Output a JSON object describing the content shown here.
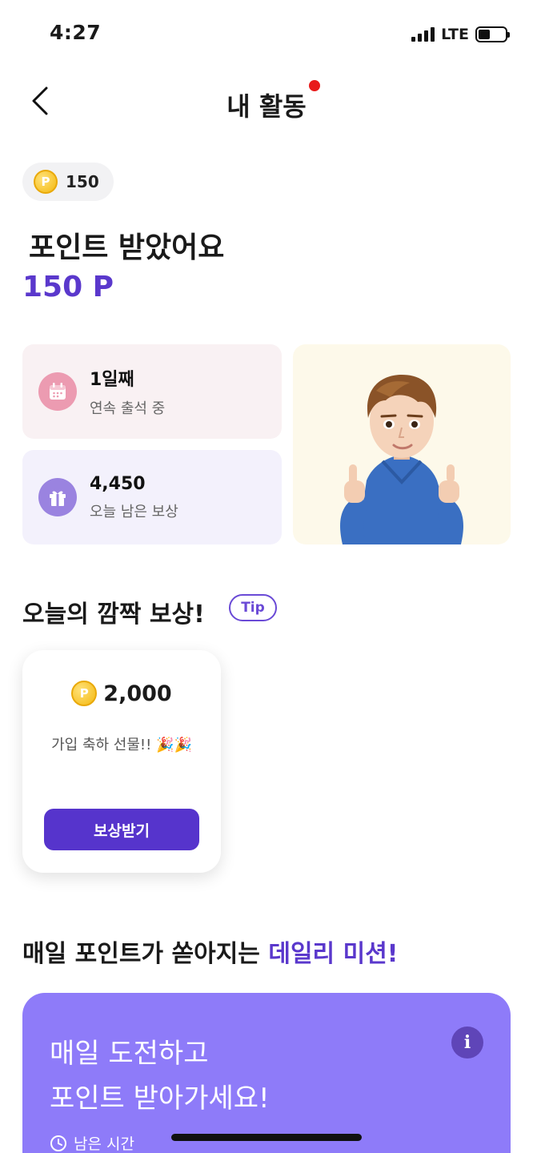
{
  "status_bar": {
    "time": "4:27",
    "network": "LTE"
  },
  "header": {
    "title": "내 활동"
  },
  "points": {
    "chip_symbol": "P",
    "chip_value": "150",
    "headline": "포인트 받았어요",
    "amount": "150 P"
  },
  "stats": {
    "attendance_value": "1일째",
    "attendance_label": "연속 출석 중",
    "reward_value": "4,450",
    "reward_label": "오늘 남은 보상"
  },
  "surprise": {
    "title": "오늘의 깜짝 보상!",
    "tip_label": "Tip",
    "card": {
      "coin_symbol": "P",
      "amount": "2,000",
      "message": "가입 축하 선물!! 🎉🎉",
      "button_label": "보상받기"
    }
  },
  "daily_mission": {
    "title_prefix": "매일 포인트가 쏟아지는 ",
    "title_accent": "데일리 미션!",
    "card_line1": "매일 도전하고",
    "card_line2": "포인트 받아가세요!",
    "info_label": "i",
    "remaining_label": "남은 시간"
  },
  "colors": {
    "accent": "#5a38cc",
    "mission_bg": "#8e7bf9",
    "button": "#5634cc"
  }
}
